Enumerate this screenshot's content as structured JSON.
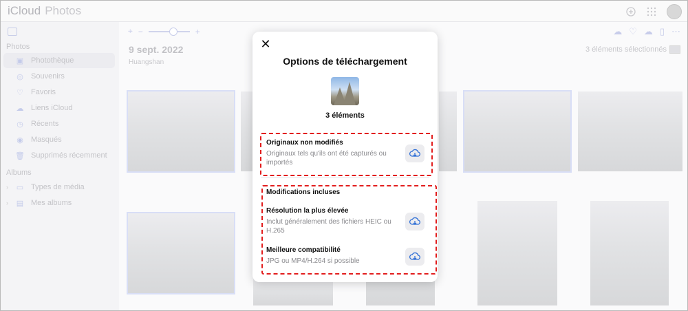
{
  "app": {
    "brand_a": "iCloud",
    "brand_b": "Photos"
  },
  "sidebar": {
    "section_photos": "Photos",
    "items": [
      {
        "label": "Photothèque",
        "icon": "photos-icon"
      },
      {
        "label": "Souvenirs",
        "icon": "memories-icon"
      },
      {
        "label": "Favoris",
        "icon": "heart-icon"
      },
      {
        "label": "Liens iCloud",
        "icon": "cloud-link-icon"
      },
      {
        "label": "Récents",
        "icon": "clock-icon"
      },
      {
        "label": "Masqués",
        "icon": "eye-icon"
      },
      {
        "label": "Supprimés récemment",
        "icon": "trash-icon"
      }
    ],
    "section_albums": "Albums",
    "album_items": [
      {
        "label": "Types de média",
        "icon": "folder-icon"
      },
      {
        "label": "Mes albums",
        "icon": "albums-icon"
      }
    ]
  },
  "main": {
    "date": "9 sept. 2022",
    "location": "Huangshan",
    "selection_count": "3 éléments sélectionnés"
  },
  "modal": {
    "title": "Options de téléchargement",
    "count": "3 éléments",
    "option1": {
      "title": "Originaux non modifiés",
      "desc": "Originaux tels qu'ils ont été capturés ou importés"
    },
    "section2_title": "Modifications incluses",
    "option2": {
      "title": "Résolution la plus élevée",
      "desc": "Inclut généralement des fichiers HEIC ou H.265"
    },
    "option3": {
      "title": "Meilleure compatibilité",
      "desc": "JPG ou MP4/H.264 si possible"
    }
  },
  "colors": {
    "highlight": "#e21d1d",
    "accent": "#2f6fd6"
  }
}
